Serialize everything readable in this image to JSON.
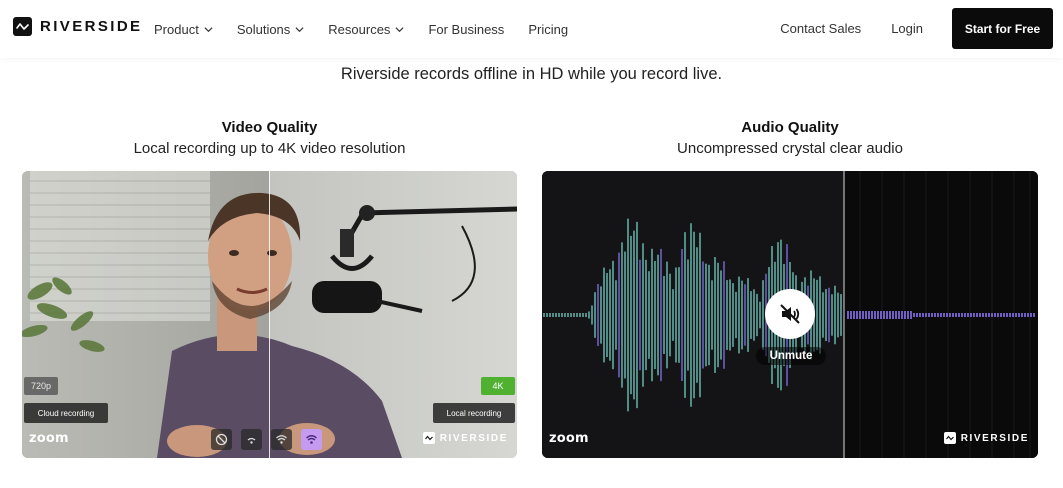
{
  "nav": {
    "brand": "RIVERSIDE",
    "menu": [
      {
        "label": "Product",
        "dropdown": true
      },
      {
        "label": "Solutions",
        "dropdown": true
      },
      {
        "label": "Resources",
        "dropdown": true
      },
      {
        "label": "For Business",
        "dropdown": false
      },
      {
        "label": "Pricing",
        "dropdown": false
      }
    ],
    "contact_sales": "Contact Sales",
    "login": "Login",
    "cta": "Start for Free"
  },
  "hero": {
    "tagline": "Riverside records offline in HD while you record live."
  },
  "video": {
    "title": "Video Quality",
    "subtitle": "Local recording up to 4K video resolution",
    "left_resolution": "720p",
    "right_resolution": "4K",
    "left_mode": "Cloud recording",
    "right_mode": "Local recording",
    "left_brand": "zoom",
    "right_brand": "RIVERSIDE"
  },
  "audio": {
    "title": "Audio Quality",
    "subtitle": "Uncompressed crystal clear audio",
    "unmute_label": "Unmute",
    "left_brand": "zoom",
    "right_brand": "RIVERSIDE"
  },
  "colors": {
    "cta_bg": "#0b0b0b",
    "badge_4k": "#4fb12f",
    "wave_teal": "#76d3c8",
    "wave_purple": "#8a74f0",
    "active_control": "#c49bf0"
  },
  "icons": {
    "logo": "riverside-wave-logo-icon",
    "chevron": "chevron-down-icon",
    "controls": [
      "disabled-icon",
      "signal-weak-icon",
      "signal-medium-icon",
      "wifi-strong-icon"
    ],
    "unmute": "speaker-muted-icon"
  }
}
